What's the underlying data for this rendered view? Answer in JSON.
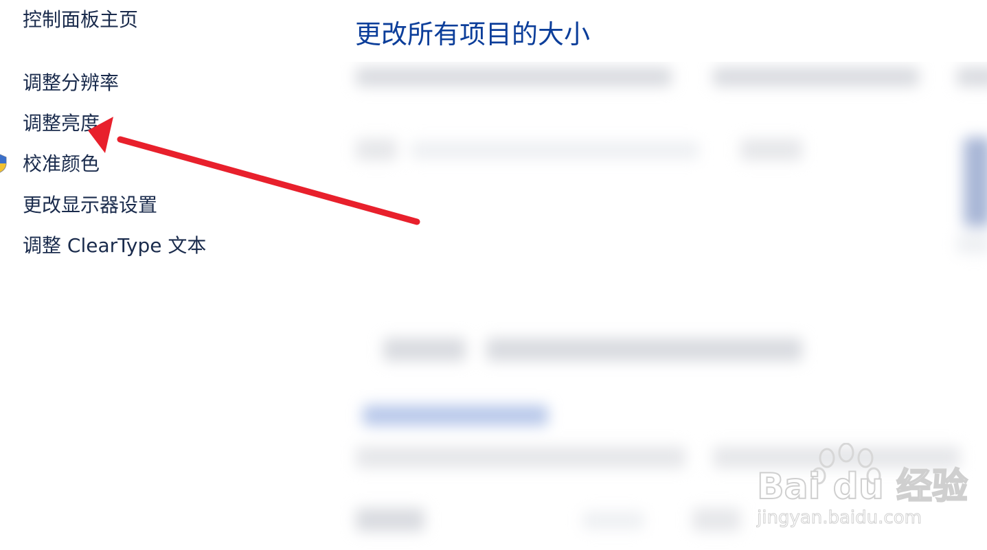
{
  "sidebar": {
    "items": [
      {
        "label": "控制面板主页"
      },
      {
        "label": "调整分辨率"
      },
      {
        "label": "调整亮度"
      },
      {
        "label": "校准颜色"
      },
      {
        "label": "更改显示器设置"
      },
      {
        "label": "调整 ClearType 文本"
      }
    ]
  },
  "main": {
    "title": "更改所有项目的大小"
  },
  "icons": {
    "shield": "uac-shield-icon",
    "arrow": "red-annotation-arrow",
    "watermark": "baidu-paw-logo"
  },
  "colors": {
    "title": "#0c3e9a",
    "link": "#1a2b4c",
    "arrow": "#e8202c"
  },
  "watermark": {
    "brand": "Bai du 经验",
    "url": "jingyan.baidu.com"
  }
}
